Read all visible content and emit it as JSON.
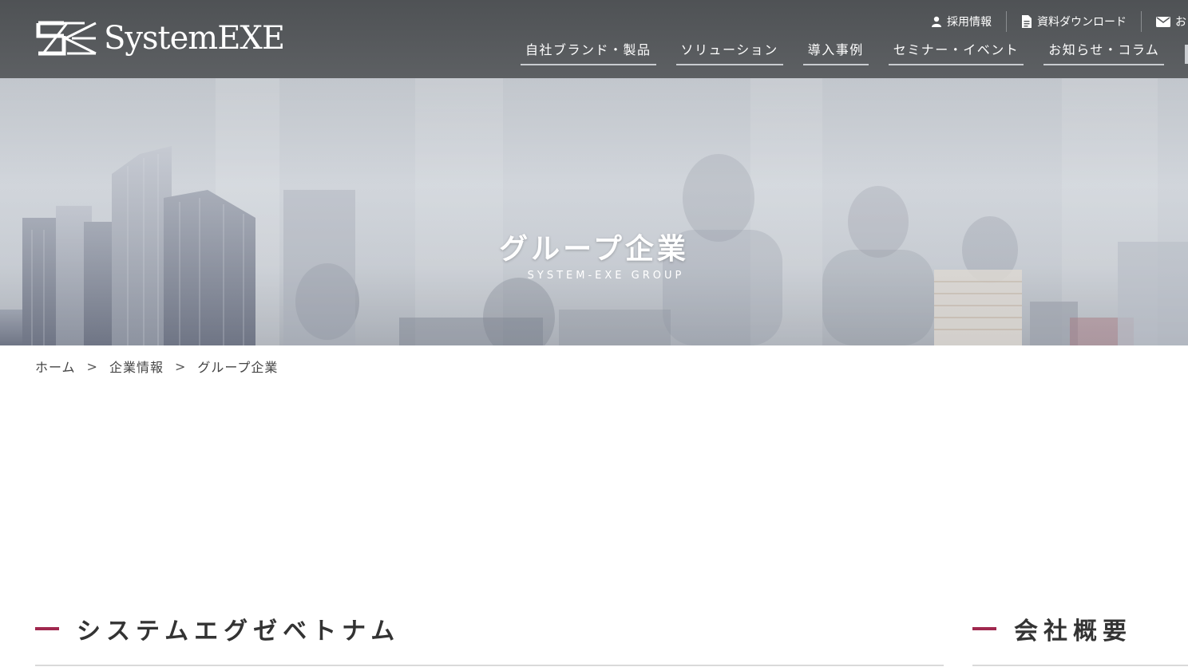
{
  "header": {
    "logo_text": "SystemEXE",
    "utility_links": [
      {
        "label": "採用情報",
        "icon": "user-icon"
      },
      {
        "label": "資料ダウンロード",
        "icon": "document-icon"
      },
      {
        "label": "お",
        "icon": "mail-icon"
      }
    ],
    "nav": [
      {
        "label": "自社ブランド・製品"
      },
      {
        "label": "ソリューション"
      },
      {
        "label": "導入事例"
      },
      {
        "label": "セミナー・イベント"
      },
      {
        "label": "お知らせ・コラム"
      }
    ]
  },
  "hero": {
    "title": "グループ企業",
    "subtitle": "SYSTEM-EXE GROUP"
  },
  "breadcrumb": {
    "items": [
      "ホーム",
      "企業情報",
      "グループ企業"
    ],
    "separator": ">"
  },
  "sections": {
    "main_title": "システムエグゼベトナム",
    "side_title": "会社概要"
  },
  "colors": {
    "header_bg": "#55585b",
    "accent": "#a0284e",
    "text": "#333333"
  }
}
